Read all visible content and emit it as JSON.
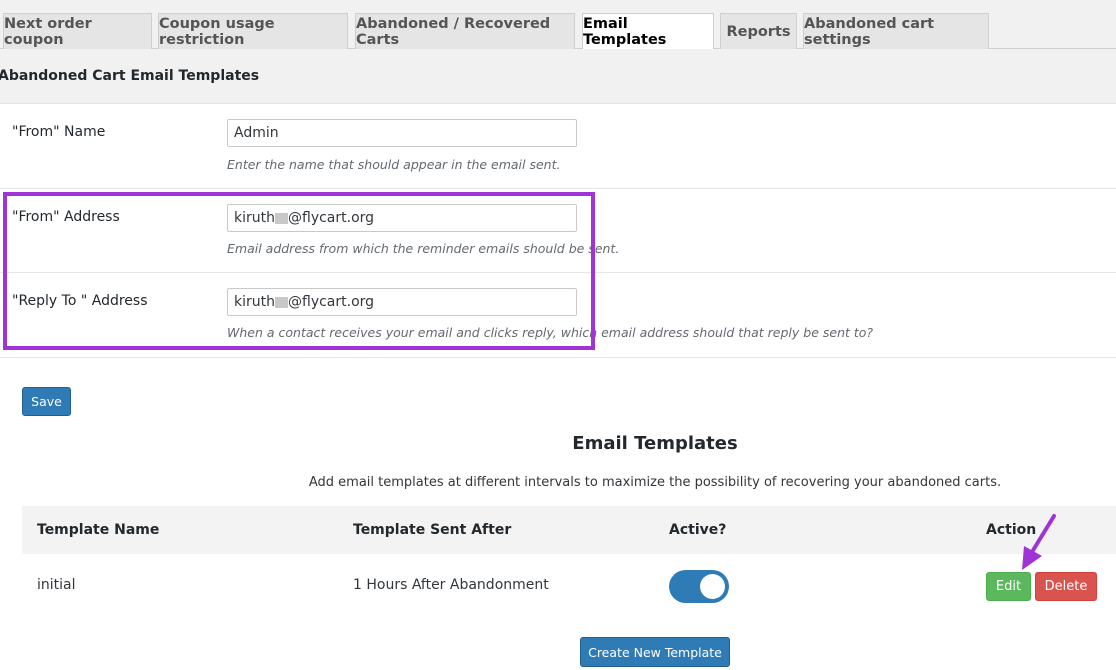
{
  "tabs": [
    {
      "label": "Next order coupon"
    },
    {
      "label": "Coupon usage restriction"
    },
    {
      "label": "Abandoned / Recovered Carts"
    },
    {
      "label": "Email Templates"
    },
    {
      "label": "Reports"
    },
    {
      "label": "Abandoned cart settings"
    }
  ],
  "active_tab": "Email Templates",
  "section_title": "Abandoned Cart Email Templates",
  "fields": {
    "from_name": {
      "label": "\"From\" Name",
      "value": "Admin",
      "description": "Enter the name that should appear in the email sent."
    },
    "from_address": {
      "label": "\"From\" Address",
      "value_prefix": "kiruth",
      "value_suffix": "@flycart.org",
      "description": "Email address from which the reminder emails should be sent."
    },
    "reply_to": {
      "label": "\"Reply To \" Address",
      "value_prefix": "kiruth",
      "value_suffix": "@flycart.org",
      "description": "When a contact receives your email and clicks reply, which email address should that reply be sent to?"
    }
  },
  "save_label": "Save",
  "email_templates": {
    "title": "Email Templates",
    "description": "Add email templates at different intervals to maximize the possibility of recovering your abandoned carts.",
    "columns": {
      "name": "Template Name",
      "sent_after": "Template Sent After",
      "active": "Active?",
      "action": "Action"
    },
    "rows": [
      {
        "name": "initial",
        "sent_after": "1 Hours After Abandonment",
        "active": true,
        "edit_label": "Edit",
        "delete_label": "Delete"
      }
    ],
    "create_label": "Create New Template"
  },
  "colors": {
    "primary": "#2f7bb6",
    "success": "#5cb85c",
    "danger": "#d9534f",
    "highlight": "#a033d6"
  },
  "icons": {
    "annotation_arrow": "arrow-down-left-icon"
  }
}
